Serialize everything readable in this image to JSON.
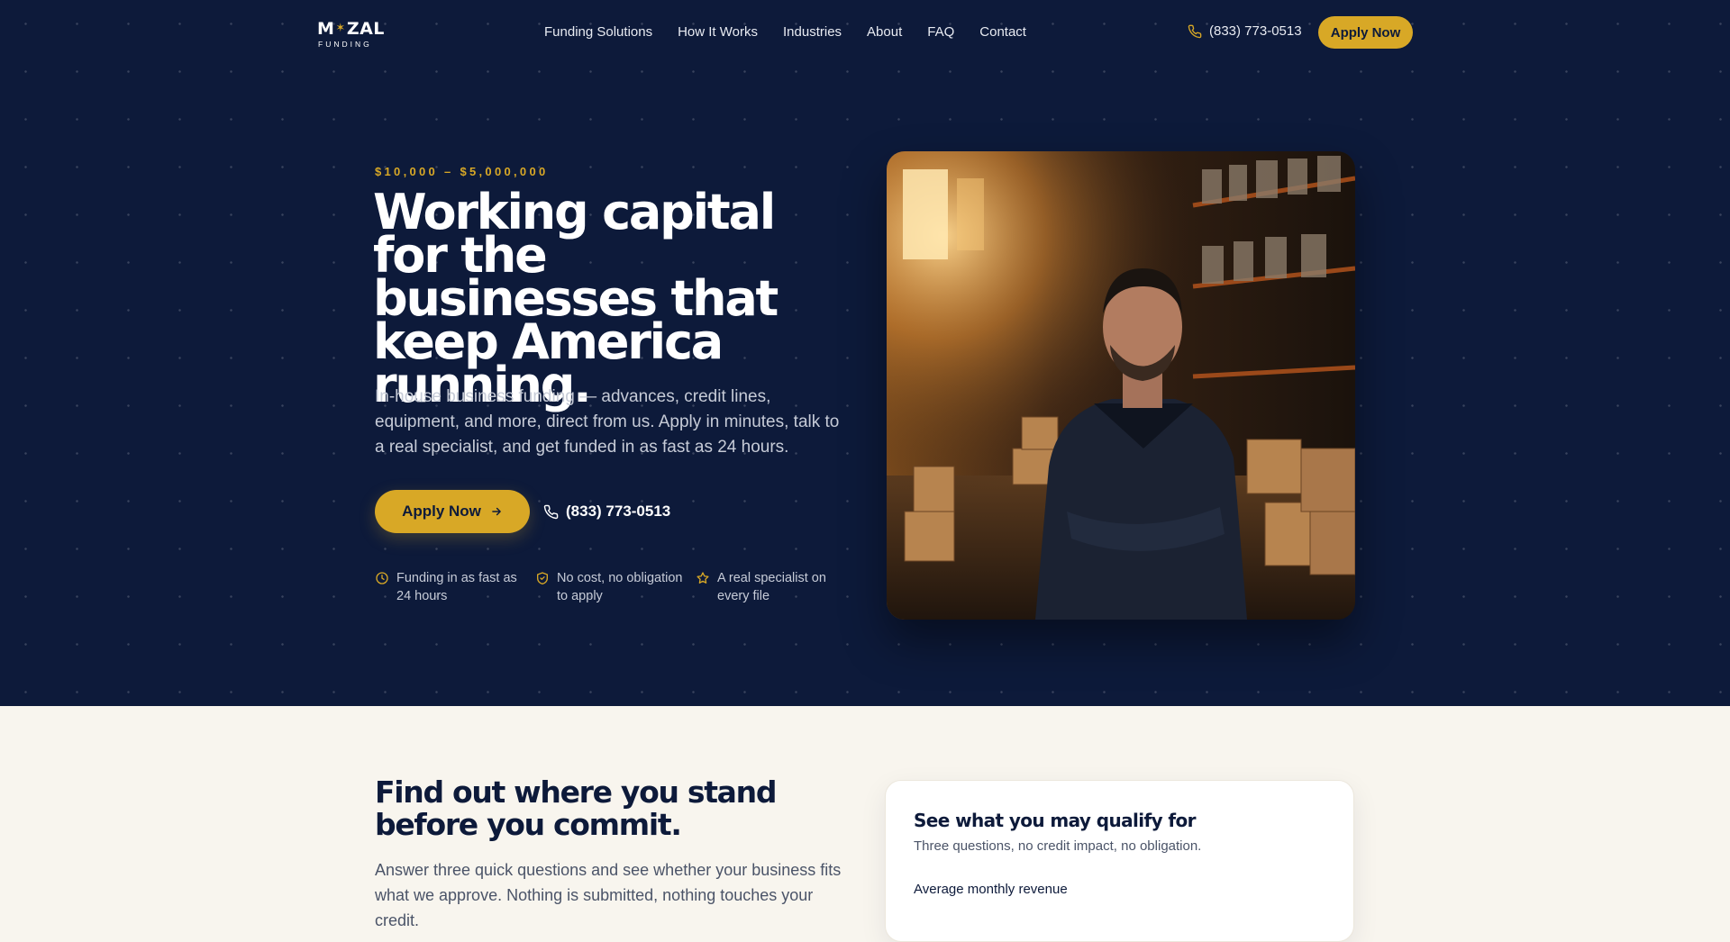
{
  "header": {
    "logo": {
      "main_left": "M",
      "main_right": "ZAL",
      "star": "✶",
      "sub": "FUNDING"
    },
    "nav": [
      {
        "label": "Funding Solutions"
      },
      {
        "label": "How It Works"
      },
      {
        "label": "Industries"
      },
      {
        "label": "About"
      },
      {
        "label": "FAQ"
      },
      {
        "label": "Contact"
      }
    ],
    "phone": "(833) 773-0513",
    "apply_label": "Apply Now"
  },
  "hero": {
    "eyebrow": "$10,000 – $5,000,000",
    "title": "Working capital for the businesses that keep America running.",
    "subtitle": "In-house business funding — advances, credit lines, equipment, and more, direct from us. Apply in minutes, talk to a real specialist, and get funded in as fast as 24 hours.",
    "apply_label": "Apply Now",
    "phone": "(833) 773-0513",
    "features": [
      {
        "icon": "clock-icon",
        "text": "Funding in as fast as 24 hours"
      },
      {
        "icon": "shield-check-icon",
        "text": "No cost, no obligation to apply"
      },
      {
        "icon": "star-icon",
        "text": "A real specialist on every file"
      }
    ]
  },
  "qualify_section": {
    "title": "Find out where you stand before you commit.",
    "subtitle": "Answer three quick questions and see whether your business fits what we approve. Nothing is submitted, nothing touches your credit.",
    "card": {
      "title": "See what you may qualify for",
      "subtitle": "Three questions, no credit impact, no obligation.",
      "first_question_label": "Average monthly revenue"
    }
  },
  "colors": {
    "navy": "#0d1a3a",
    "gold": "#d8a826",
    "cream": "#f8f5ee"
  }
}
